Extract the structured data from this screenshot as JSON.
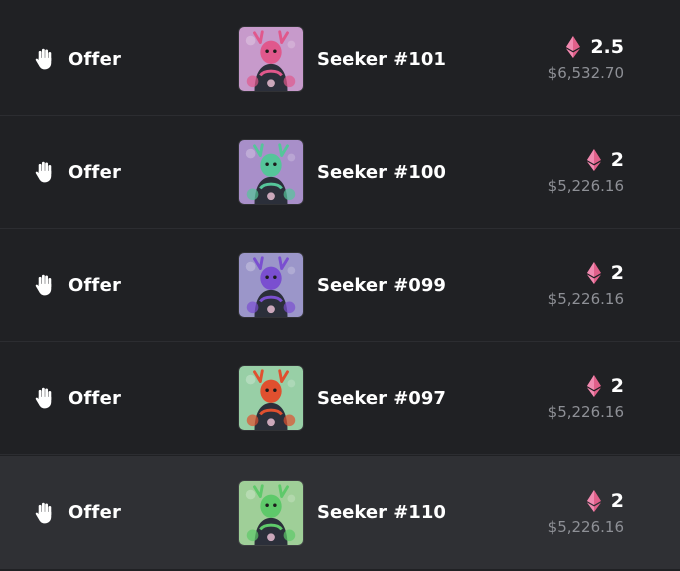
{
  "colors": {
    "background": "#202124",
    "row_highlight": "#2f3034",
    "eth_accent": "#e0608a",
    "usd_text": "#8e9096"
  },
  "icons": {
    "event": "hand-icon",
    "currency": "ethereum-icon"
  },
  "rows": [
    {
      "event": "Offer",
      "name": "Seeker #101",
      "eth": "2.5",
      "usd": "$6,532.70",
      "thumb_bg": "#c79acb",
      "char_color": "#e0588c"
    },
    {
      "event": "Offer",
      "name": "Seeker #100",
      "eth": "2",
      "usd": "$5,226.16",
      "thumb_bg": "#a88fc9",
      "char_color": "#55c59a"
    },
    {
      "event": "Offer",
      "name": "Seeker #099",
      "eth": "2",
      "usd": "$5,226.16",
      "thumb_bg": "#9b96c9",
      "char_color": "#7a4fd0"
    },
    {
      "event": "Offer",
      "name": "Seeker #097",
      "eth": "2",
      "usd": "$5,226.16",
      "thumb_bg": "#98cfa6",
      "char_color": "#e0502f"
    },
    {
      "event": "Offer",
      "name": "Seeker #110",
      "eth": "2",
      "usd": "$5,226.16",
      "thumb_bg": "#9fcf98",
      "char_color": "#5ec96a"
    }
  ]
}
